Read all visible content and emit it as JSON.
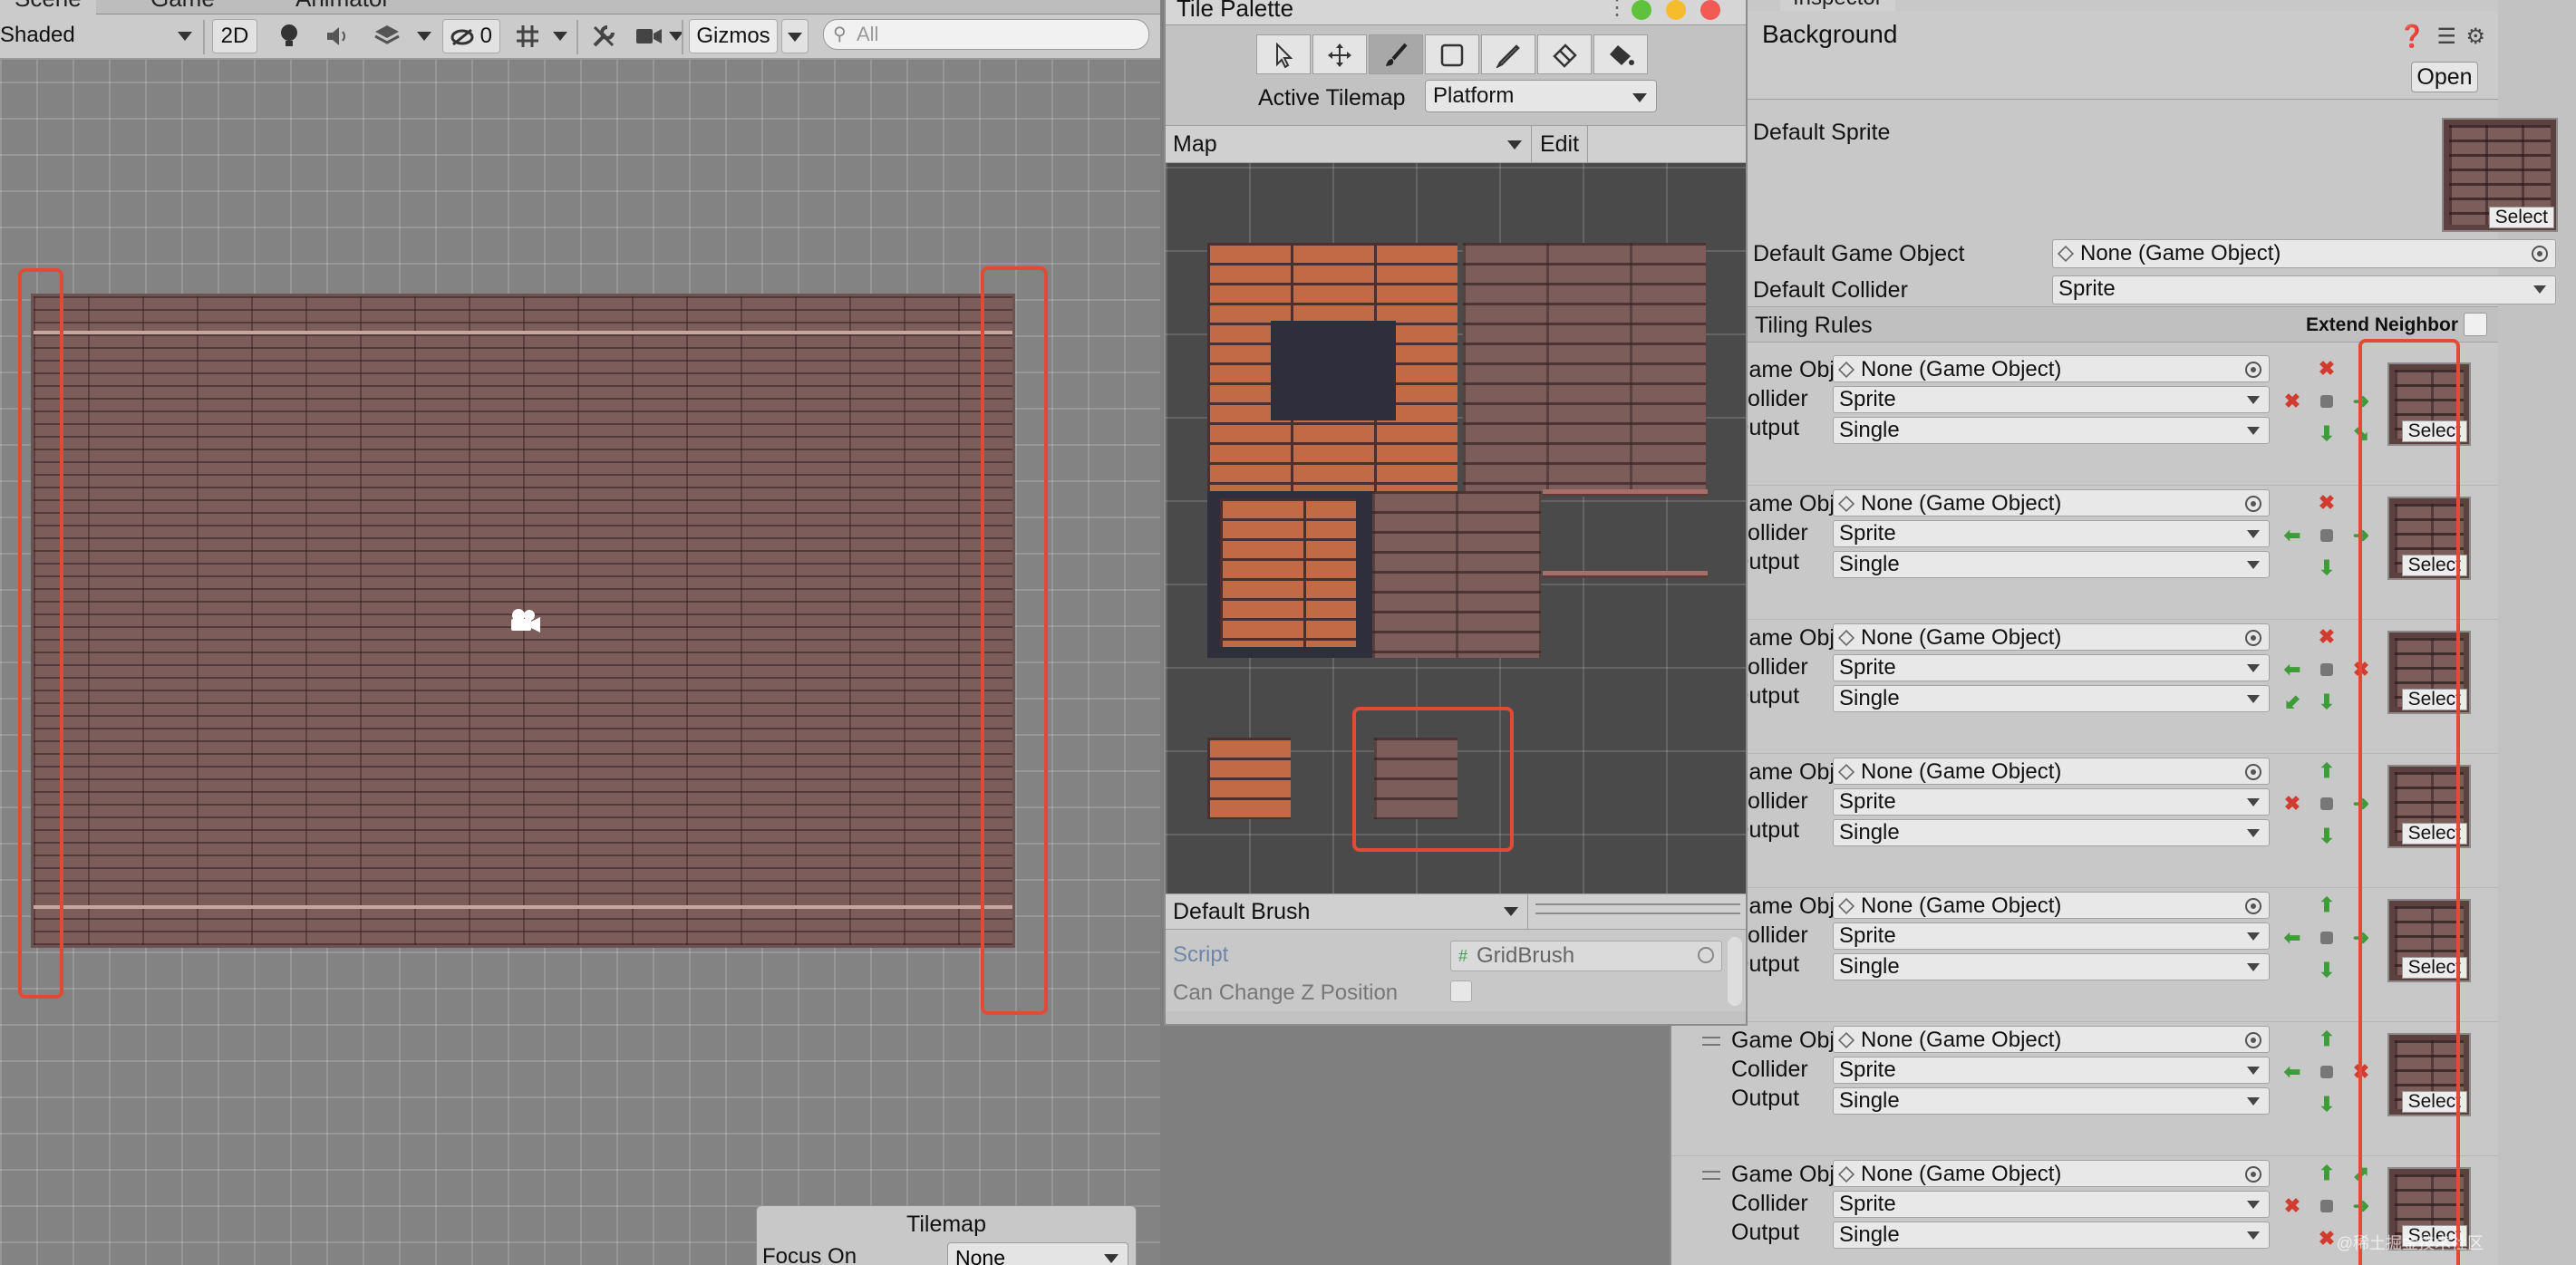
{
  "scene": {
    "tabs": [
      "Scene",
      "Game",
      "Animator"
    ],
    "shading_mode": "Shaded",
    "mode_2d": "2D",
    "hidden_count": "0",
    "gizmos": "Gizmos",
    "search_placeholder": "All"
  },
  "tilemap_overlay": {
    "title": "Tilemap",
    "focus_label": "Focus On",
    "focus_value": "None"
  },
  "palette": {
    "title": "Tile Palette",
    "tools": [
      "select-tool-icon",
      "move-tool-icon",
      "paint-brush-icon",
      "box-fill-icon",
      "picker-icon",
      "eraser-icon",
      "fill-bucket-icon"
    ],
    "active_tool": "paint-brush-icon",
    "active_tilemap_label": "Active Tilemap",
    "active_tilemap_value": "Platform",
    "palette_select": "Map",
    "edit_label": "Edit",
    "brush_select": "Default Brush",
    "script_label": "Script",
    "script_value": "GridBrush",
    "can_change_z_label": "Can Change Z Position",
    "can_change_z_checked": false
  },
  "inspector": {
    "tab_label": "Inspector",
    "title": "Background",
    "open_label": "Open",
    "default_sprite_label": "Default Sprite",
    "default_go_label": "Default Game Object",
    "default_go_value": "None (Game Object)",
    "default_collider_label": "Default Collider",
    "default_collider_value": "Sprite",
    "select_label": "Select",
    "tiling_rules_label": "Tiling Rules",
    "extend_neighbor_label": "Extend Neighbor",
    "extend_neighbor_checked": false,
    "rules": [
      {
        "game_object": "None (Game Object)",
        "collider": "Sprite",
        "output": "Single",
        "neighbors": {
          "n": "x",
          "w": "x",
          "e": "arrow-right",
          "s": "arrow-down",
          "se": "arrow-down-right"
        }
      },
      {
        "game_object": "None (Game Object)",
        "collider": "Sprite",
        "output": "Single",
        "neighbors": {
          "n": "x",
          "w": "arrow-left",
          "e": "arrow-right",
          "s": "arrow-down"
        }
      },
      {
        "game_object": "None (Game Object)",
        "collider": "Sprite",
        "output": "Single",
        "neighbors": {
          "n": "x",
          "w": "arrow-left",
          "e": "x",
          "s": "arrow-down",
          "sw": "arrow-down-left"
        }
      },
      {
        "game_object": "None (Game Object)",
        "collider": "Sprite",
        "output": "Single",
        "neighbors": {
          "n": "arrow-up",
          "w": "x",
          "e": "arrow-right",
          "s": "arrow-down"
        }
      },
      {
        "game_object": "None (Game Object)",
        "collider": "Sprite",
        "output": "Single",
        "neighbors": {
          "n": "arrow-up",
          "w": "arrow-left",
          "e": "arrow-right",
          "s": "arrow-down"
        }
      },
      {
        "game_object": "None (Game Object)",
        "collider": "Sprite",
        "output": "Single",
        "neighbors": {
          "n": "arrow-up",
          "w": "arrow-left",
          "e": "x",
          "s": "arrow-down"
        }
      },
      {
        "game_object": "None (Game Object)",
        "collider": "Sprite",
        "output": "Single",
        "neighbors": {
          "n": "arrow-up",
          "ne": "arrow-up-right",
          "w": "x",
          "e": "arrow-right",
          "s": "x"
        }
      }
    ],
    "rule_labels": {
      "game_object": "Game Object",
      "collider": "Collider",
      "output": "Output"
    },
    "watermark": "@稀土掘金技术社区"
  },
  "colors": {
    "highlight_red": "#e04a37",
    "arrow_green": "#3e9b38",
    "x_red": "#d13b30"
  }
}
